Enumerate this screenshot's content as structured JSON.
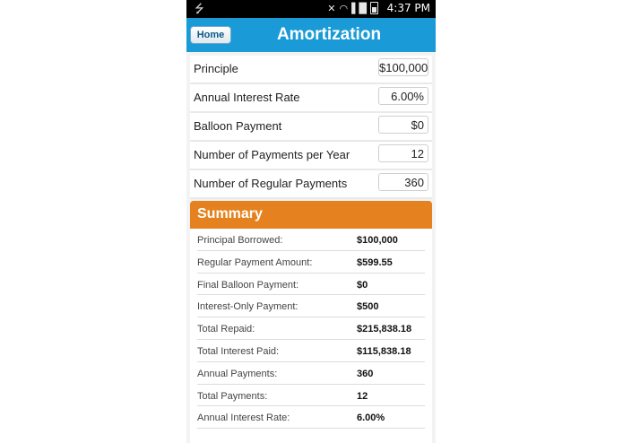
{
  "status_bar": {
    "time": "4:37 PM",
    "icons": [
      "usb-icon",
      "mute-icon",
      "wifi-icon",
      "signal-icon",
      "battery-icon"
    ]
  },
  "app_bar": {
    "home_label": "Home",
    "title": "Amortization",
    "color": "#1a9bd7"
  },
  "inputs": [
    {
      "label": "Principle",
      "value": "$100,000"
    },
    {
      "label": "Annual Interest Rate",
      "value": "6.00%"
    },
    {
      "label": "Balloon Payment",
      "value": "$0"
    },
    {
      "label": "Number of Payments per Year",
      "value": "12"
    },
    {
      "label": "Number of Regular Payments",
      "value": "360"
    }
  ],
  "summary": {
    "title": "Summary",
    "color": "#e5821f",
    "rows": [
      {
        "label": "Principal Borrowed:",
        "value": "$100,000"
      },
      {
        "label": "Regular Payment Amount:",
        "value": "$599.55"
      },
      {
        "label": "Final Balloon Payment:",
        "value": "$0"
      },
      {
        "label": "Interest-Only Payment:",
        "value": "$500"
      },
      {
        "label": "Total Repaid:",
        "value": "$215,838.18"
      },
      {
        "label": "Total Interest Paid:",
        "value": "$115,838.18"
      },
      {
        "label": "Annual Payments:",
        "value": "360"
      },
      {
        "label": "Total Payments:",
        "value": "12"
      },
      {
        "label": "Annual Interest Rate:",
        "value": "6.00%"
      }
    ]
  }
}
